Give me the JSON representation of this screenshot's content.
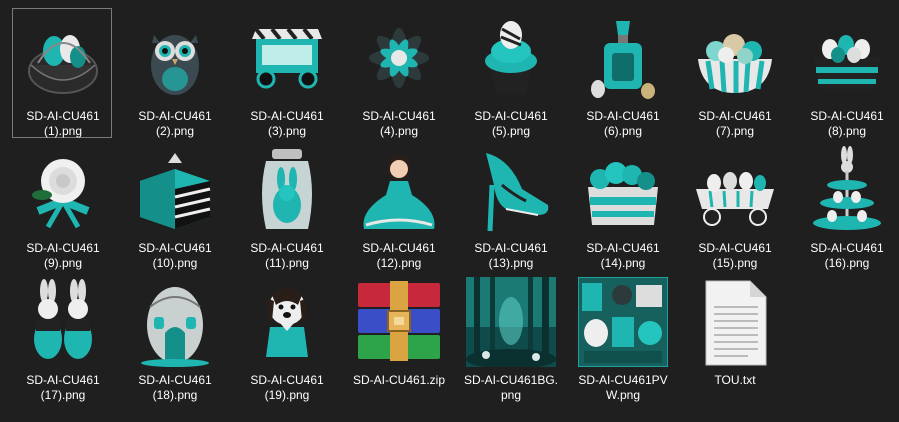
{
  "files": [
    {
      "name": "SD-AI-CU461\n(1).png",
      "icon": "egg-basket-icon"
    },
    {
      "name": "SD-AI-CU461\n(2).png",
      "icon": "owl-icon"
    },
    {
      "name": "SD-AI-CU461\n(3).png",
      "icon": "candy-cart-icon"
    },
    {
      "name": "SD-AI-CU461\n(4).png",
      "icon": "teal-flower-icon"
    },
    {
      "name": "SD-AI-CU461\n(5).png",
      "icon": "cupcake-icon"
    },
    {
      "name": "SD-AI-CU461\n(6).png",
      "icon": "perfume-bottle-icon"
    },
    {
      "name": "SD-AI-CU461\n(7).png",
      "icon": "macaron-bowl-icon"
    },
    {
      "name": "SD-AI-CU461\n(8).png",
      "icon": "egg-bowl-icon"
    },
    {
      "name": "SD-AI-CU461\n(9).png",
      "icon": "white-rose-icon"
    },
    {
      "name": "SD-AI-CU461\n(10).png",
      "icon": "cake-icon"
    },
    {
      "name": "SD-AI-CU461\n(11).png",
      "icon": "bunny-jar-icon"
    },
    {
      "name": "SD-AI-CU461\n(12).png",
      "icon": "girl-dress-icon"
    },
    {
      "name": "SD-AI-CU461\n(13).png",
      "icon": "high-heel-icon"
    },
    {
      "name": "SD-AI-CU461\n(14).png",
      "icon": "flower-box-icon"
    },
    {
      "name": "SD-AI-CU461\n(15).png",
      "icon": "egg-wagon-icon"
    },
    {
      "name": "SD-AI-CU461\n(16).png",
      "icon": "tiered-stand-icon"
    },
    {
      "name": "SD-AI-CU461\n(17).png",
      "icon": "bunnies-icon"
    },
    {
      "name": "SD-AI-CU461\n(18).png",
      "icon": "egg-house-icon"
    },
    {
      "name": "SD-AI-CU461\n(19).png",
      "icon": "puppy-icon"
    },
    {
      "name": "SD-AI-CU461.zip",
      "icon": "winrar-archive-icon"
    },
    {
      "name": "SD-AI-CU461BG.\npng",
      "icon": "forest-background-icon"
    },
    {
      "name": "SD-AI-CU461PV\nW.png",
      "icon": "preview-collage-icon"
    },
    {
      "name": "TOU.txt",
      "icon": "text-file-icon"
    }
  ],
  "selected_index": 0,
  "colors": {
    "background": "#1f1f1f",
    "teal": "#1fb5b0",
    "text": "#ffffff",
    "selection_border": "#7a7a7a"
  }
}
